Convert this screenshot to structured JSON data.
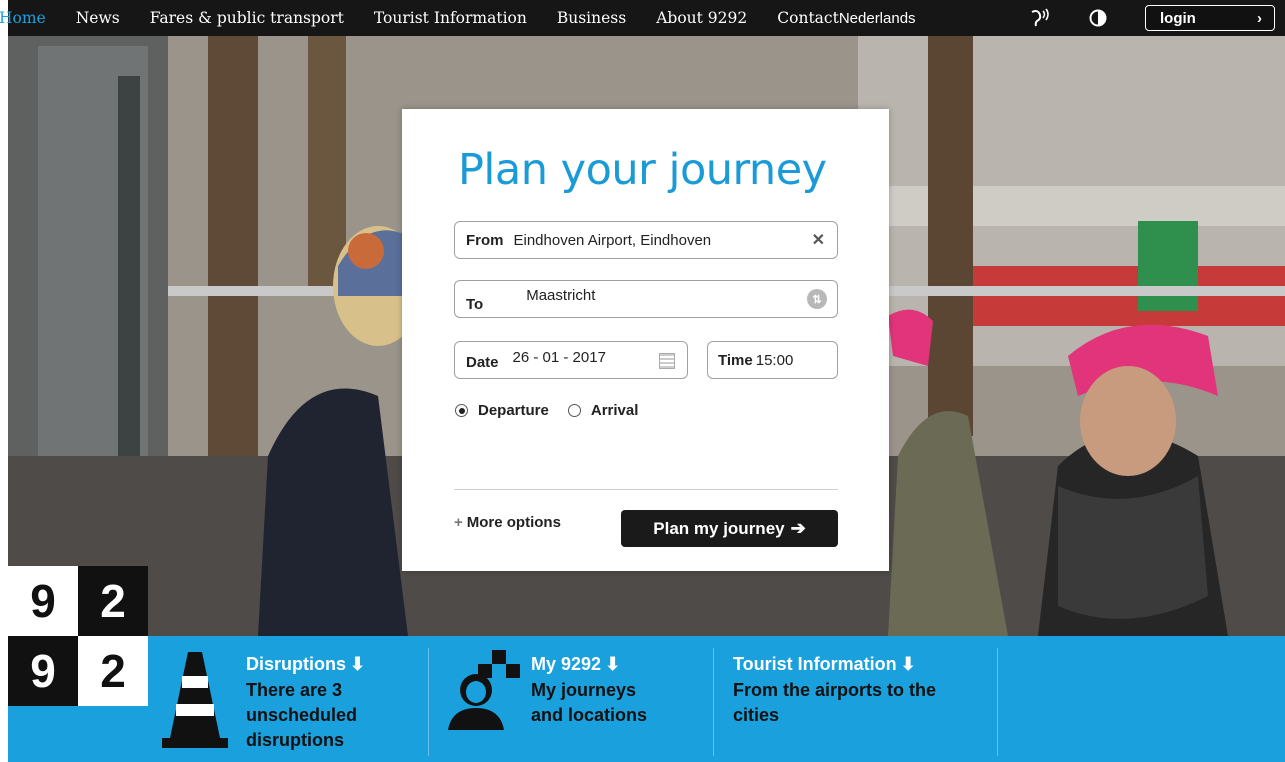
{
  "nav": {
    "items": [
      "Home",
      "News",
      "Fares & public transport",
      "Tourist Information",
      "Business",
      "About 9292",
      "Contact"
    ],
    "active": "Home",
    "language": "Nederlands",
    "login_label": "login"
  },
  "journey": {
    "title": "Plan your journey",
    "from_label": "From",
    "from_value": "Eindhoven Airport, Eindhoven",
    "to_label": "To",
    "to_value": "Maastricht",
    "date_label": "Date",
    "date_value": "26 - 01 - 2017",
    "time_label": "Time",
    "time_value": "15:00",
    "departure_label": "Departure",
    "arrival_label": "Arrival",
    "selected_mode": "Departure",
    "more_options": "More options",
    "plan_button": "Plan my journey"
  },
  "logo": {
    "digits": [
      "9",
      "2",
      "9",
      "2"
    ]
  },
  "bottom": {
    "disruptions": {
      "title": "Disruptions",
      "text": [
        "There are 3",
        "unscheduled",
        "disruptions"
      ]
    },
    "my9292": {
      "title": "My 9292",
      "text": [
        "My journeys",
        "and locations"
      ]
    },
    "tourist": {
      "title": "Tourist Information",
      "text": [
        "From the airports to the",
        "cities"
      ]
    }
  },
  "colors": {
    "accent": "#1aa0dc",
    "title_blue": "#1a9ad6",
    "nav_bg": "#161616"
  },
  "icons": [
    "hearing-icon",
    "contrast-icon",
    "chevron-right-icon",
    "clear-icon",
    "swap-icon",
    "calendar-icon",
    "plus-icon",
    "arrow-right-icon",
    "traffic-cone-icon",
    "user-icon",
    "arrow-down-icon"
  ]
}
